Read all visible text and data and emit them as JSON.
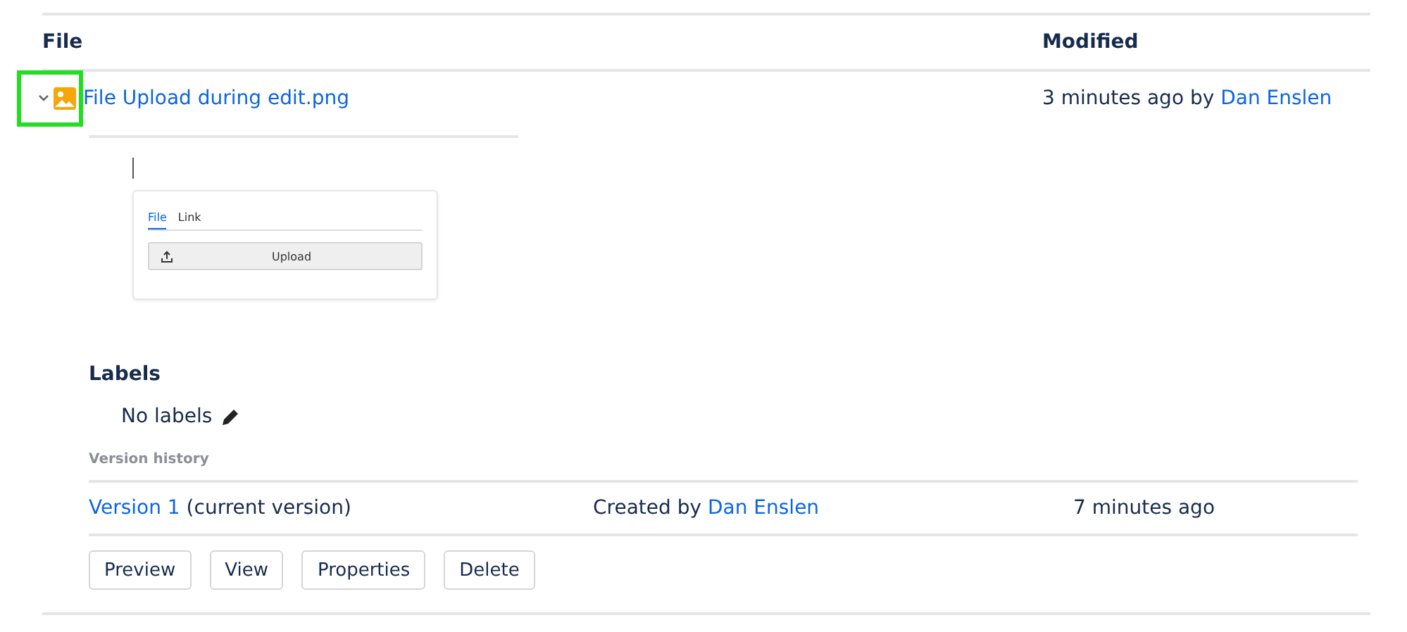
{
  "table": {
    "columns": [
      "File",
      "Modified"
    ],
    "rows": [
      {
        "expanded": true,
        "highlighted": true,
        "name": "File Upload during edit.png",
        "modified": "3 minutes ago by",
        "author": "Dan Enslen"
      }
    ]
  },
  "preview": {
    "tabs": [
      {
        "label": "File",
        "selected": true
      },
      {
        "label": "Link",
        "selected": false
      }
    ],
    "upload_button": "Upload"
  },
  "labels": {
    "heading": "Labels",
    "empty_text": "No labels"
  },
  "version_history": {
    "heading": "Version history",
    "versions": [
      {
        "link": "Version 1",
        "note": "(current version)",
        "created_prefix": "Created by",
        "author": "Dan Enslen",
        "time": "7 minutes ago"
      }
    ]
  },
  "buttons": [
    "Preview",
    "View",
    "Properties",
    "Delete"
  ]
}
